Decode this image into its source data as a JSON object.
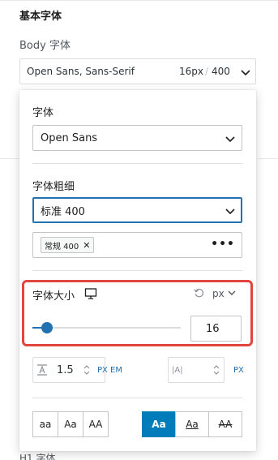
{
  "panel": {
    "section_title": "基本字体",
    "field_label": "Body 字体",
    "summary": {
      "family": "Open Sans, Sans-Serif",
      "size": "16px",
      "separator": "/",
      "weight": "400"
    },
    "next_section_label": "H1 字体"
  },
  "popover": {
    "font_label": "字体",
    "font_value": "Open Sans",
    "weight_label": "字体粗细",
    "weight_value": "标准 400",
    "variant_chip": "常规 400",
    "variant_chip_remove": "✕",
    "more_options": "•••",
    "size_label": "字体大小",
    "size_unit": "px",
    "size_value": "16",
    "size_slider_level": 0.1,
    "line_height_value": "1.5",
    "line_height_units": [
      "PX",
      "EM"
    ],
    "letter_spacing_placeholder": "|A|",
    "letter_spacing_unit": "PX",
    "text_transform": [
      "aa",
      "Aa",
      "AA"
    ],
    "text_decoration": [
      "Aa",
      "Aa",
      "AA"
    ],
    "selected_decoration_index": 0
  },
  "colors": {
    "accent": "#2271b1",
    "selected": "#007cba",
    "highlight": "#e2453d"
  }
}
